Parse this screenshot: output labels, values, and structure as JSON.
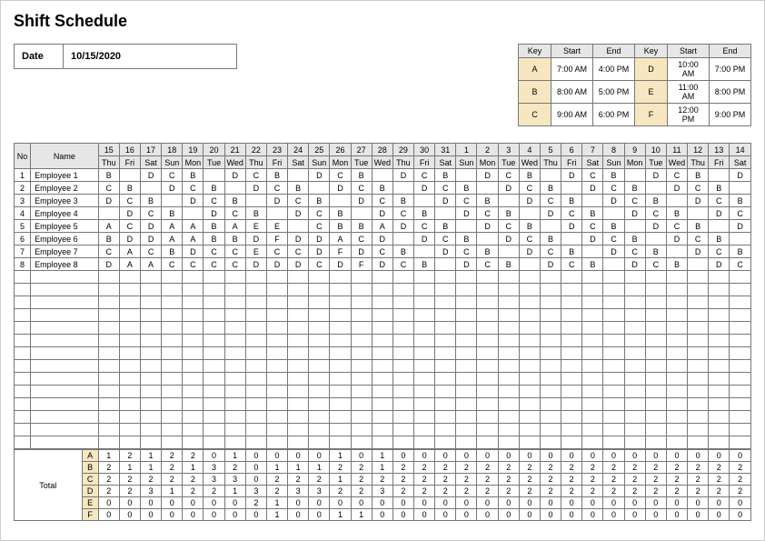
{
  "title": "Shift Schedule",
  "date_label": "Date",
  "date_value": "10/15/2020",
  "key_headers": [
    "Key",
    "Start",
    "End",
    "Key",
    "Start",
    "End"
  ],
  "key_rows": [
    [
      "A",
      "7:00 AM",
      "4:00 PM",
      "D",
      "10:00 AM",
      "7:00 PM"
    ],
    [
      "B",
      "8:00 AM",
      "5:00 PM",
      "E",
      "11:00 AM",
      "8:00 PM"
    ],
    [
      "C",
      "9:00 AM",
      "6:00 PM",
      "F",
      "12:00 PM",
      "9:00 PM"
    ]
  ],
  "schedule": {
    "no_label": "No",
    "name_label": "Name",
    "days_num": [
      "15",
      "16",
      "17",
      "18",
      "19",
      "20",
      "21",
      "22",
      "23",
      "24",
      "25",
      "26",
      "27",
      "28",
      "29",
      "30",
      "31",
      "1",
      "2",
      "3",
      "4",
      "5",
      "6",
      "7",
      "8",
      "9",
      "10",
      "11",
      "12",
      "13",
      "14"
    ],
    "days_dow": [
      "Thu",
      "Fri",
      "Sat",
      "Sun",
      "Mon",
      "Tue",
      "Wed",
      "Thu",
      "Fri",
      "Sat",
      "Sun",
      "Mon",
      "Tue",
      "Wed",
      "Thu",
      "Fri",
      "Sat",
      "Sun",
      "Mon",
      "Tue",
      "Wed",
      "Thu",
      "Fri",
      "Sat",
      "Sun",
      "Mon",
      "Tue",
      "Wed",
      "Thu",
      "Fri",
      "Sat"
    ],
    "rows": [
      {
        "no": "1",
        "name": "Employee 1",
        "cells": [
          "B",
          "",
          "D",
          "C",
          "B",
          "",
          "D",
          "C",
          "B",
          "",
          "D",
          "C",
          "B",
          "",
          "D",
          "C",
          "B",
          "",
          "D",
          "C",
          "B",
          "",
          "D",
          "C",
          "B",
          "",
          "D",
          "C",
          "B",
          "",
          "D"
        ]
      },
      {
        "no": "2",
        "name": "Employee 2",
        "cells": [
          "C",
          "B",
          "",
          "D",
          "C",
          "B",
          "",
          "D",
          "C",
          "B",
          "",
          "D",
          "C",
          "B",
          "",
          "D",
          "C",
          "B",
          "",
          "D",
          "C",
          "B",
          "",
          "D",
          "C",
          "B",
          "",
          "D",
          "C",
          "B",
          ""
        ]
      },
      {
        "no": "3",
        "name": "Employee 3",
        "cells": [
          "D",
          "C",
          "B",
          "",
          "D",
          "C",
          "B",
          "",
          "D",
          "C",
          "B",
          "",
          "D",
          "C",
          "B",
          "",
          "D",
          "C",
          "B",
          "",
          "D",
          "C",
          "B",
          "",
          "D",
          "C",
          "B",
          "",
          "D",
          "C",
          "B"
        ]
      },
      {
        "no": "4",
        "name": "Employee 4",
        "cells": [
          "",
          "D",
          "C",
          "B",
          "",
          "D",
          "C",
          "B",
          "",
          "D",
          "C",
          "B",
          "",
          "D",
          "C",
          "B",
          "",
          "D",
          "C",
          "B",
          "",
          "D",
          "C",
          "B",
          "",
          "D",
          "C",
          "B",
          "",
          "D",
          "C"
        ]
      },
      {
        "no": "5",
        "name": "Employee 5",
        "cells": [
          "A",
          "C",
          "D",
          "A",
          "A",
          "B",
          "A",
          "E",
          "E",
          "",
          "C",
          "B",
          "B",
          "A",
          "D",
          "C",
          "B",
          "",
          "D",
          "C",
          "B",
          "",
          "D",
          "C",
          "B",
          "",
          "D",
          "C",
          "B",
          "",
          "D"
        ]
      },
      {
        "no": "6",
        "name": "Employee 6",
        "cells": [
          "B",
          "D",
          "D",
          "A",
          "A",
          "B",
          "B",
          "D",
          "F",
          "D",
          "D",
          "A",
          "C",
          "D",
          "",
          "D",
          "C",
          "B",
          "",
          "D",
          "C",
          "B",
          "",
          "D",
          "C",
          "B",
          "",
          "D",
          "C",
          "B",
          ""
        ]
      },
      {
        "no": "7",
        "name": "Employee 7",
        "cells": [
          "C",
          "A",
          "C",
          "B",
          "D",
          "C",
          "C",
          "E",
          "C",
          "C",
          "D",
          "F",
          "D",
          "C",
          "B",
          "",
          "D",
          "C",
          "B",
          "",
          "D",
          "C",
          "B",
          "",
          "D",
          "C",
          "B",
          "",
          "D",
          "C",
          "B"
        ]
      },
      {
        "no": "8",
        "name": "Employee 8",
        "cells": [
          "D",
          "A",
          "A",
          "C",
          "C",
          "C",
          "C",
          "D",
          "D",
          "D",
          "C",
          "D",
          "F",
          "D",
          "C",
          "B",
          "",
          "D",
          "C",
          "B",
          "",
          "D",
          "C",
          "B",
          "",
          "D",
          "C",
          "B",
          "",
          "D",
          "C"
        ]
      }
    ],
    "blank_rows": 14
  },
  "total": {
    "label": "Total",
    "keys": [
      "A",
      "B",
      "C",
      "D",
      "E",
      "F"
    ],
    "rows": [
      [
        "1",
        "2",
        "1",
        "2",
        "2",
        "0",
        "1",
        "0",
        "0",
        "0",
        "0",
        "1",
        "0",
        "1",
        "0",
        "0",
        "0",
        "0",
        "0",
        "0",
        "0",
        "0",
        "0",
        "0",
        "0",
        "0",
        "0",
        "0",
        "0",
        "0",
        "0"
      ],
      [
        "2",
        "1",
        "1",
        "2",
        "1",
        "3",
        "2",
        "0",
        "1",
        "1",
        "1",
        "2",
        "2",
        "1",
        "2",
        "2",
        "2",
        "2",
        "2",
        "2",
        "2",
        "2",
        "2",
        "2",
        "2",
        "2",
        "2",
        "2",
        "2",
        "2",
        "2"
      ],
      [
        "2",
        "2",
        "2",
        "2",
        "2",
        "3",
        "3",
        "0",
        "2",
        "2",
        "2",
        "1",
        "2",
        "2",
        "2",
        "2",
        "2",
        "2",
        "2",
        "2",
        "2",
        "2",
        "2",
        "2",
        "2",
        "2",
        "2",
        "2",
        "2",
        "2",
        "2"
      ],
      [
        "2",
        "2",
        "3",
        "1",
        "2",
        "2",
        "1",
        "3",
        "2",
        "3",
        "3",
        "2",
        "2",
        "3",
        "2",
        "2",
        "2",
        "2",
        "2",
        "2",
        "2",
        "2",
        "2",
        "2",
        "2",
        "2",
        "2",
        "2",
        "2",
        "2",
        "2"
      ],
      [
        "0",
        "0",
        "0",
        "0",
        "0",
        "0",
        "0",
        "2",
        "1",
        "0",
        "0",
        "0",
        "0",
        "0",
        "0",
        "0",
        "0",
        "0",
        "0",
        "0",
        "0",
        "0",
        "0",
        "0",
        "0",
        "0",
        "0",
        "0",
        "0",
        "0",
        "0"
      ],
      [
        "0",
        "0",
        "0",
        "0",
        "0",
        "0",
        "0",
        "0",
        "1",
        "0",
        "0",
        "1",
        "1",
        "0",
        "0",
        "0",
        "0",
        "0",
        "0",
        "0",
        "0",
        "0",
        "0",
        "0",
        "0",
        "0",
        "0",
        "0",
        "0",
        "0",
        "0"
      ]
    ]
  }
}
